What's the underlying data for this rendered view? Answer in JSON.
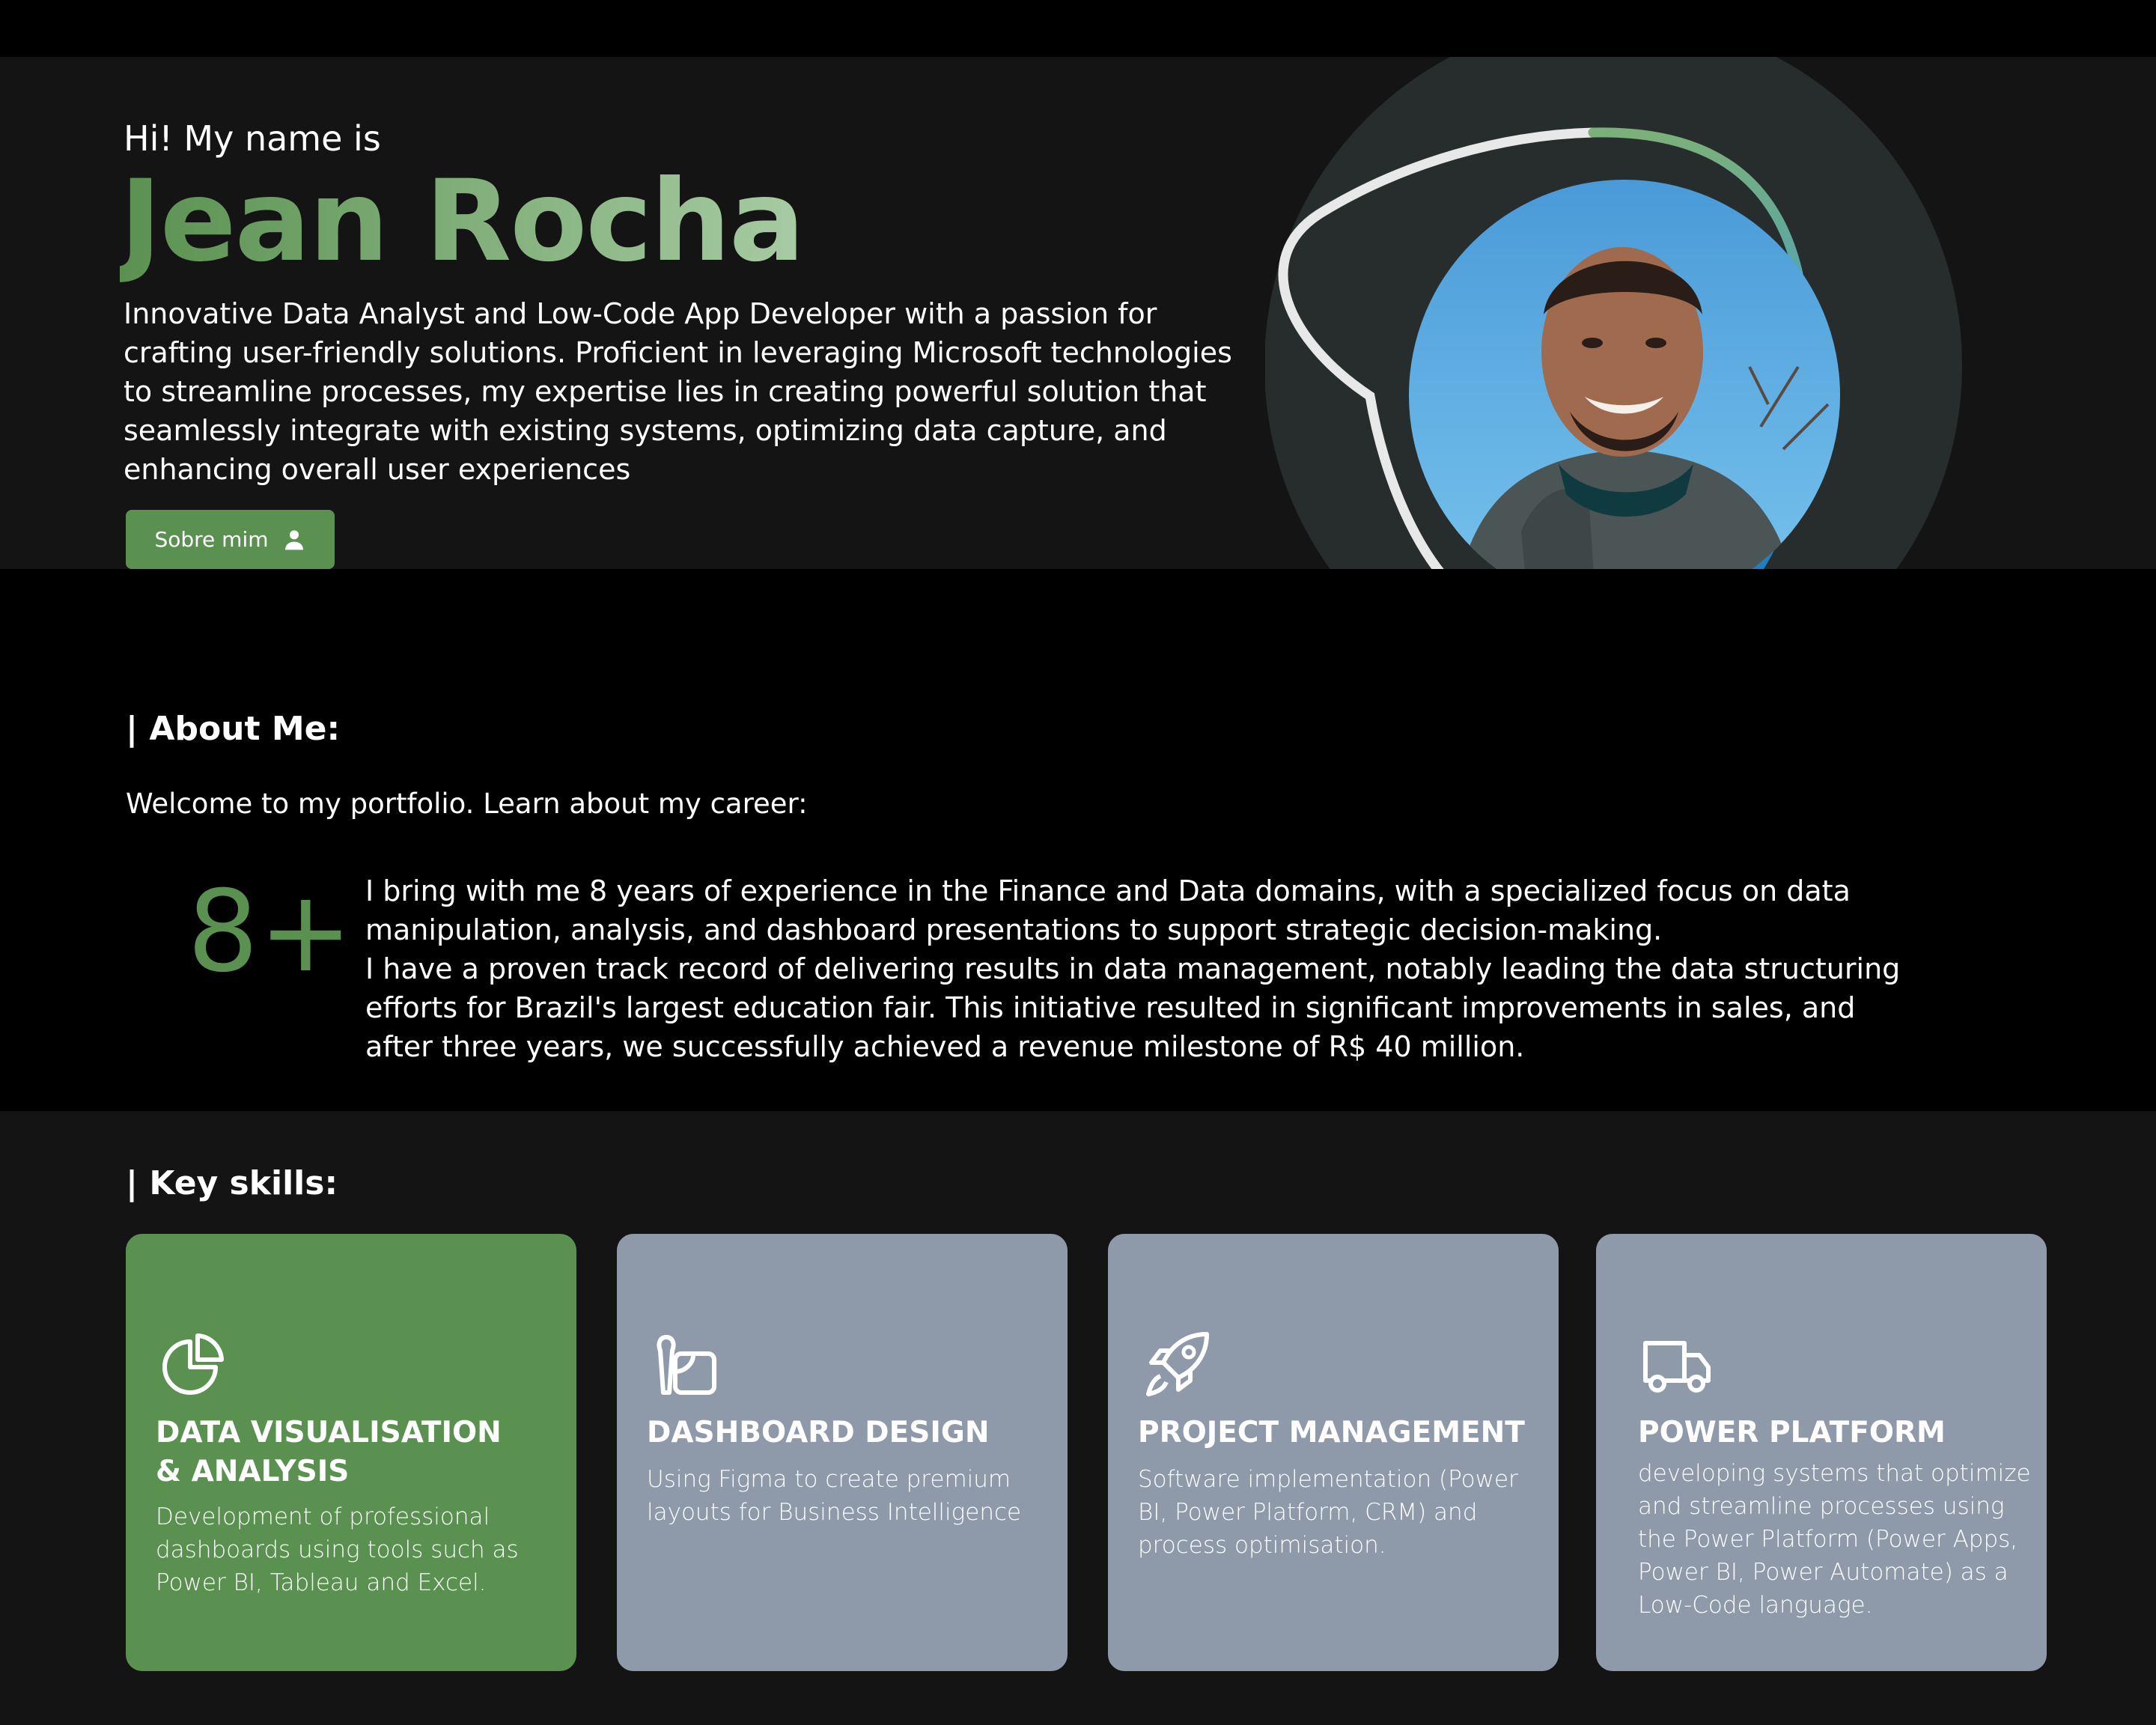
{
  "hero": {
    "greeting": "Hi! My name is",
    "name": "Jean Rocha",
    "intro": "Innovative Data Analyst and Low-Code App Developer with a passion for crafting user-friendly solutions. Proficient in leveraging Microsoft technologies to streamline processes, my expertise lies in creating powerful solution that seamlessly integrate with existing systems, optimizing data capture, and enhancing overall user experiences",
    "about_button": "Sobre mim",
    "about_button_icon": "user-icon",
    "play_icon": "play-icon"
  },
  "about": {
    "heading": "| About Me:",
    "welcome": "Welcome to my portfolio. Learn about my career:",
    "years": "8+",
    "paragraph1": " I bring with me 8 years of experience in the Finance and Data domains, with a specialized focus on data manipulation, analysis, and dashboard presentations to support strategic decision-making.",
    "paragraph2": " I have a proven track record of delivering results in data management, notably leading the data structuring efforts for Brazil's largest education fair. This initiative resulted in significant improvements in sales, and after three years, we successfully achieved a revenue milestone of R$ 40 million."
  },
  "skills": {
    "heading": "| Key skills:",
    "cards": [
      {
        "icon": "pie-chart-icon",
        "title_line1": "DATA VISUALISATION",
        "title_line2": "& ANALYSIS",
        "description": "Development of professional dashboards using tools such as Power BI, Tableau and Excel."
      },
      {
        "icon": "design-tools-icon",
        "title": "DASHBOARD DESIGN",
        "description": "Using Figma  to create premium layouts for Business Intelligence"
      },
      {
        "icon": "rocket-icon",
        "title": "PROJECT MANAGEMENT",
        "description": "Software implementation (Power BI, Power Platform, CRM) and process optimisation."
      },
      {
        "icon": "truck-icon",
        "title": "POWER PLATFORM",
        "description": "developing systems that optimize and streamline processes using the Power Platform (Power Apps, Power BI, Power Automate) as a Low-Code language."
      }
    ]
  },
  "colors": {
    "accent_green": "#5a9150",
    "card_grey": "#8e9aaa",
    "hero_bg": "#141414",
    "play_blue": "#1f7fd6",
    "play_orange": "#f39019"
  }
}
